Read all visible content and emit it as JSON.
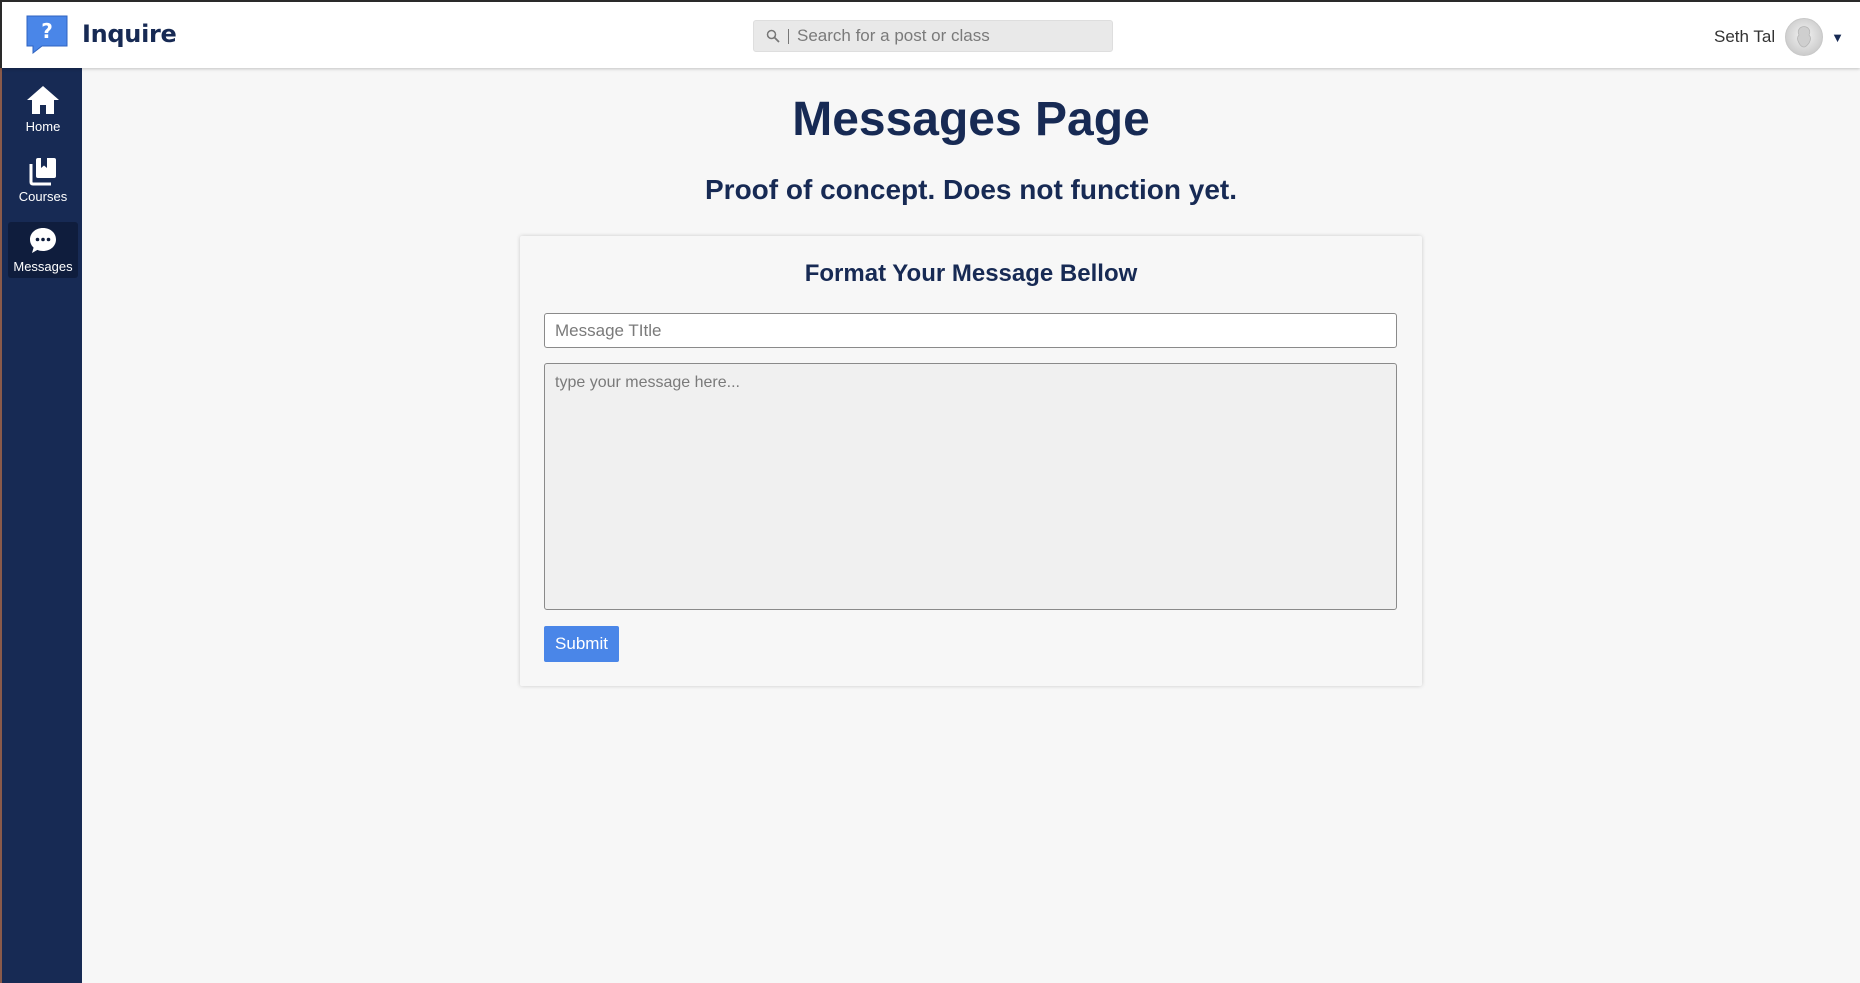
{
  "app": {
    "name": "Inquire",
    "logo_icon": "question-speech-bubble-icon",
    "accent_color": "#4a86e8",
    "brand_navy": "#172a54"
  },
  "header": {
    "search": {
      "placeholder": "Search for a post or class",
      "value": "",
      "icon": "search-icon"
    },
    "user": {
      "name": "Seth Tal",
      "avatar_icon": "avatar-icon",
      "menu_icon": "caret-down-icon"
    }
  },
  "sidebar": {
    "items": [
      {
        "label": "Home",
        "icon": "home-icon",
        "active": false
      },
      {
        "label": "Courses",
        "icon": "courses-icon",
        "active": false
      },
      {
        "label": "Messages",
        "icon": "chat-bubble-icon",
        "active": true
      }
    ]
  },
  "main": {
    "title": "Messages Page",
    "subtitle": "Proof of concept. Does not function yet.",
    "form": {
      "heading": "Format Your Message Bellow",
      "title_placeholder": "Message TItle",
      "title_value": "",
      "message_placeholder": "type your message here...",
      "message_value": "",
      "submit_label": "Submit"
    }
  }
}
